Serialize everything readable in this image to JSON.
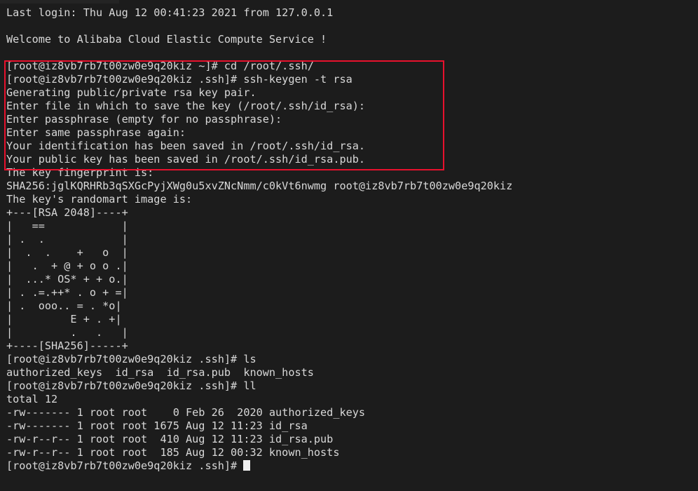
{
  "terminal": {
    "background_color": "#1c1c1c",
    "foreground_color": "#d8d8d8",
    "annotation_color": "#e8112d",
    "cursor_color": "#f2f2f2",
    "hostname": "iz8vb7rb7t00zw0e9q20kiz",
    "user": "root"
  },
  "lines": [
    {
      "id": "last-login",
      "text": "Last login: Thu Aug 12 00:41:23 2021 from 127.0.0.1"
    },
    {
      "id": "blank-1",
      "text": " "
    },
    {
      "id": "welcome",
      "text": "Welcome to Alibaba Cloud Elastic Compute Service !"
    },
    {
      "id": "blank-2",
      "text": " "
    },
    {
      "id": "prompt-cd",
      "text": "[root@iz8vb7rb7t00zw0e9q20kiz ~]# cd /root/.ssh/"
    },
    {
      "id": "prompt-keygen",
      "text": "[root@iz8vb7rb7t00zw0e9q20kiz .ssh]# ssh-keygen -t rsa"
    },
    {
      "id": "generating",
      "text": "Generating public/private rsa key pair."
    },
    {
      "id": "enter-file",
      "text": "Enter file in which to save the key (/root/.ssh/id_rsa): "
    },
    {
      "id": "enter-passphrase",
      "text": "Enter passphrase (empty for no passphrase): "
    },
    {
      "id": "enter-same",
      "text": "Enter same passphrase again: "
    },
    {
      "id": "saved-identity",
      "text": "Your identification has been saved in /root/.ssh/id_rsa."
    },
    {
      "id": "saved-public",
      "text": "Your public key has been saved in /root/.ssh/id_rsa.pub."
    },
    {
      "id": "fingerprint-label",
      "text": "The key fingerprint is:"
    },
    {
      "id": "fingerprint-value",
      "text": "SHA256:jglKQRHRb3qSXGcPyjXWg0u5xvZNcNmm/c0kVt6nwmg root@iz8vb7rb7t00zw0e9q20kiz"
    },
    {
      "id": "randomart-label",
      "text": "The key's randomart image is:"
    },
    {
      "id": "randomart-top",
      "text": "+---[RSA 2048]----+"
    },
    {
      "id": "randomart-r1",
      "text": "|   ==            |"
    },
    {
      "id": "randomart-r2",
      "text": "| .  .            |"
    },
    {
      "id": "randomart-r3",
      "text": "|  .  .    +   o  |"
    },
    {
      "id": "randomart-r4",
      "text": "|   .  + @ + o o .|"
    },
    {
      "id": "randomart-r5",
      "text": "|  ...* OS* + + o.|"
    },
    {
      "id": "randomart-r6",
      "text": "| . .=.++* . o + =|"
    },
    {
      "id": "randomart-r7",
      "text": "| .  ooo.. = . *o|"
    },
    {
      "id": "randomart-r8",
      "text": "|         E + . +|"
    },
    {
      "id": "randomart-r9",
      "text": "|         .   .   |"
    },
    {
      "id": "randomart-bottom",
      "text": "+----[SHA256]-----+"
    },
    {
      "id": "prompt-ls",
      "text": "[root@iz8vb7rb7t00zw0e9q20kiz .ssh]# ls"
    },
    {
      "id": "ls-output",
      "text": "authorized_keys  id_rsa  id_rsa.pub  known_hosts"
    },
    {
      "id": "prompt-ll",
      "text": "[root@iz8vb7rb7t00zw0e9q20kiz .ssh]# ll"
    },
    {
      "id": "ll-total",
      "text": "total 12"
    },
    {
      "id": "ll-row-1",
      "text": "-rw------- 1 root root    0 Feb 26  2020 authorized_keys"
    },
    {
      "id": "ll-row-2",
      "text": "-rw------- 1 root root 1675 Aug 12 11:23 id_rsa"
    },
    {
      "id": "ll-row-3",
      "text": "-rw-r--r-- 1 root root  410 Aug 12 11:23 id_rsa.pub"
    },
    {
      "id": "ll-row-4",
      "text": "-rw-r--r-- 1 root root  185 Aug 12 00:32 known_hosts"
    },
    {
      "id": "prompt-final",
      "text": "[root@iz8vb7rb7t00zw0e9q20kiz .ssh]# "
    }
  ],
  "listing": {
    "columns": [
      "permissions",
      "links",
      "owner",
      "group",
      "size",
      "month",
      "day",
      "time",
      "name"
    ],
    "total_label": "total 12",
    "rows": [
      {
        "permissions": "-rw-------",
        "links": "1",
        "owner": "root",
        "group": "root",
        "size": "0",
        "month": "Feb",
        "day": "26",
        "time": "2020",
        "name": "authorized_keys"
      },
      {
        "permissions": "-rw-------",
        "links": "1",
        "owner": "root",
        "group": "root",
        "size": "1675",
        "month": "Aug",
        "day": "12",
        "time": "11:23",
        "name": "id_rsa"
      },
      {
        "permissions": "-rw-r--r--",
        "links": "1",
        "owner": "root",
        "group": "root",
        "size": "410",
        "month": "Aug",
        "day": "12",
        "time": "11:23",
        "name": "id_rsa.pub"
      },
      {
        "permissions": "-rw-r--r--",
        "links": "1",
        "owner": "root",
        "group": "root",
        "size": "185",
        "month": "Aug",
        "day": "12",
        "time": "00:32",
        "name": "known_hosts"
      }
    ]
  },
  "ls_entries": [
    "authorized_keys",
    "id_rsa",
    "id_rsa.pub",
    "known_hosts"
  ],
  "annotation": {
    "name": "red-highlight-rectangle",
    "color": "#e8112d",
    "covers": "ssh-keygen command and its interactive prompts"
  }
}
